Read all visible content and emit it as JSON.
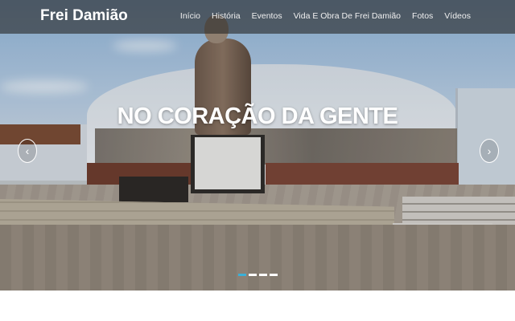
{
  "brand": {
    "name": "Frei Damião"
  },
  "nav": {
    "items": [
      {
        "label": "Início"
      },
      {
        "label": "História"
      },
      {
        "label": "Eventos"
      },
      {
        "label": "Vida E Obra De Frei Damião"
      },
      {
        "label": "Fotos"
      },
      {
        "label": "Vídeos"
      }
    ]
  },
  "carousel": {
    "caption": "NO CORAÇÃO DA GENTE",
    "prev_icon": "chevron-left-icon",
    "next_icon": "chevron-right-icon",
    "prev_glyph": "‹",
    "next_glyph": "›",
    "slide_count": 4,
    "active_index": 0,
    "indicator_active_color": "#3ab0d8"
  }
}
